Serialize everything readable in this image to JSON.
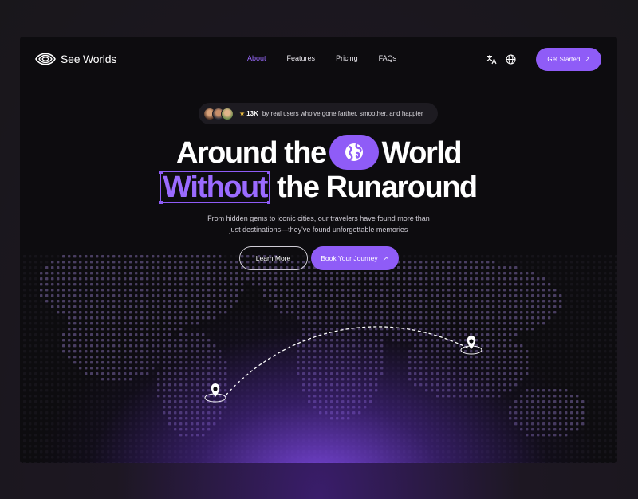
{
  "brand": {
    "name": "See Worlds"
  },
  "nav": {
    "items": [
      {
        "label": "About",
        "active": true
      },
      {
        "label": "Features",
        "active": false
      },
      {
        "label": "Pricing",
        "active": false
      },
      {
        "label": "FAQs",
        "active": false
      }
    ],
    "cta_label": "Get Started",
    "icons": [
      "translate-icon",
      "globe-icon"
    ]
  },
  "badge": {
    "count": "13K",
    "text": "by real users who've gone farther, smoother, and happier"
  },
  "hero": {
    "line1_a": "Around the",
    "line1_b": "World",
    "line2_highlight": "Without",
    "line2_rest": "the Runaround",
    "sub_line1": "From hidden gems to iconic cities, our travelers have found more than",
    "sub_line2": "just destinations—they've found unforgettable memories",
    "secondary_button": "Learn More",
    "primary_button": "Book Your Journey"
  },
  "colors": {
    "accent": "#8f5cf7",
    "accent_text": "#9b6bff",
    "frame_bg": "#0d0c0f"
  }
}
